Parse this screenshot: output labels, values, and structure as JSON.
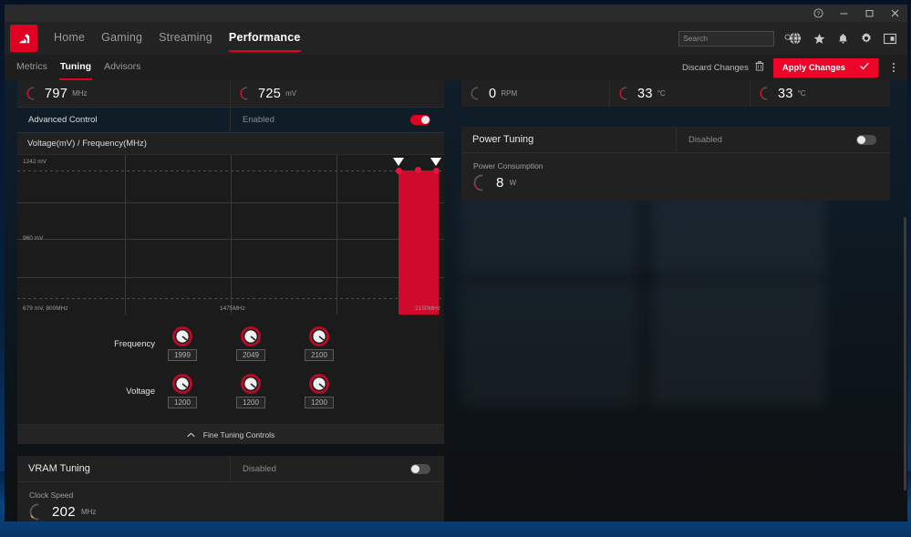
{
  "window": {
    "controls": {
      "help": "?",
      "minimize": "—",
      "maximize": "□",
      "close": "×"
    }
  },
  "nav": {
    "logo_alt": "amd-logo",
    "items": [
      {
        "label": "Home",
        "active": false
      },
      {
        "label": "Gaming",
        "active": false
      },
      {
        "label": "Streaming",
        "active": false
      },
      {
        "label": "Performance",
        "active": true
      }
    ],
    "search_placeholder": "Search",
    "icons": [
      "globe-icon",
      "star-icon",
      "bell-icon",
      "gear-icon",
      "panel-icon"
    ]
  },
  "subnav": {
    "items": [
      {
        "label": "Metrics",
        "active": false
      },
      {
        "label": "Tuning",
        "active": true
      },
      {
        "label": "Advisors",
        "active": false
      }
    ],
    "discard_label": "Discard Changes",
    "apply_label": "Apply Changes"
  },
  "stats": {
    "gpu_clock": {
      "value": "797",
      "unit": "MHz"
    },
    "gpu_voltage": {
      "value": "725",
      "unit": "mV"
    },
    "fan_speed": {
      "value": "0",
      "unit": "RPM"
    },
    "gpu_temp": {
      "value": "33",
      "unit": "°C"
    },
    "hotspot_temp": {
      "value": "33",
      "unit": "°C"
    }
  },
  "advanced_control": {
    "label": "Advanced Control",
    "state": "Enabled",
    "enabled": true
  },
  "graph": {
    "header": "Voltage(mV) / Frequency(MHz)",
    "y_top_label": "1242 mV",
    "y_mid_label": "960 mV",
    "x_left_label": "679 mV, 800MHz",
    "x_mid_label": "1475MHz",
    "x_right_label": "2150MHz"
  },
  "tuning": {
    "frequency_label": "Frequency",
    "voltage_label": "Voltage",
    "frequency_values": [
      "1999",
      "2049",
      "2100"
    ],
    "voltage_values": [
      "1200",
      "1200",
      "1200"
    ],
    "fine_tuning_label": "Fine Tuning Controls"
  },
  "power_tuning": {
    "title": "Power Tuning",
    "state": "Disabled",
    "enabled": false,
    "consumption_label": "Power Consumption",
    "consumption_value": "8",
    "consumption_unit": "W"
  },
  "vram_tuning": {
    "title": "VRAM Tuning",
    "state": "Disabled",
    "enabled": false,
    "clock_label": "Clock Speed",
    "clock_value": "202",
    "clock_unit": "MHz"
  },
  "chart_data": {
    "type": "line",
    "title": "Voltage(mV) / Frequency(MHz)",
    "xlabel": "Frequency (MHz)",
    "ylabel": "Voltage (mV)",
    "xlim": [
      800,
      2150
    ],
    "ylim": [
      679,
      1242
    ],
    "grid": true,
    "x": [
      1999,
      2049,
      2100
    ],
    "y": [
      1200,
      1200,
      1200
    ],
    "tick_labels_y": [
      "1242 mV",
      "960 mV",
      "679 mV"
    ],
    "tick_labels_x": [
      "800MHz",
      "1475MHz",
      "2150MHz"
    ],
    "annotations": [
      "679 mV, 800MHz"
    ],
    "reference_lines": [
      1242,
      679
    ]
  },
  "colors": {
    "accent": "#e00021",
    "apply_button": "#ec0528",
    "graph_fill": "#cf0a2c",
    "panel": "#212121",
    "vram_gauge": "#d8b000"
  }
}
